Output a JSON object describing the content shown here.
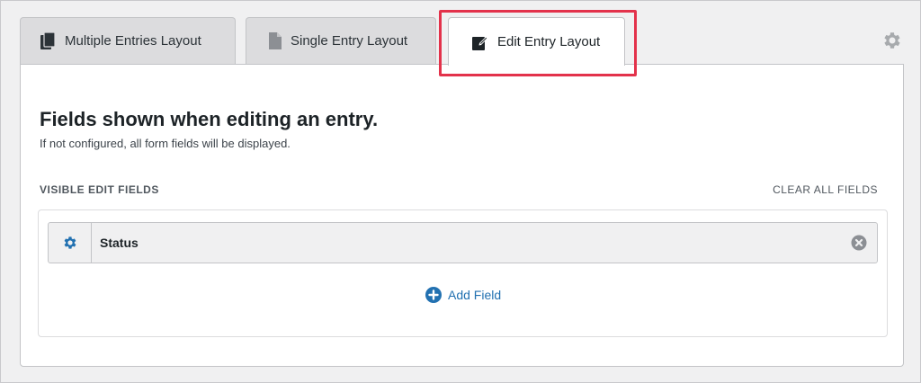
{
  "tabs": [
    {
      "label": "Multiple Entries Layout",
      "icon": "multiple-entries-icon",
      "active": false
    },
    {
      "label": "Single Entry Layout",
      "icon": "single-entry-document-icon",
      "active": false
    },
    {
      "label": "Edit Entry Layout",
      "icon": "edit-entry-icon",
      "active": true
    }
  ],
  "settings_icon": "gear-icon",
  "panel": {
    "heading": "Fields shown when editing an entry.",
    "subheading": "If not configured, all form fields will be displayed.",
    "section_label": "VISIBLE EDIT FIELDS",
    "clear_all_label": "CLEAR ALL FIELDS",
    "fields": [
      {
        "label": "Status",
        "settings_icon": "gear-icon",
        "remove_icon": "remove-circle-icon"
      }
    ],
    "add_field_label": "Add Field",
    "add_field_icon": "plus-circle-icon"
  },
  "colors": {
    "accent": "#2271b1",
    "highlight": "#e3324b",
    "background": "#f0f0f1",
    "panel": "#ffffff"
  }
}
